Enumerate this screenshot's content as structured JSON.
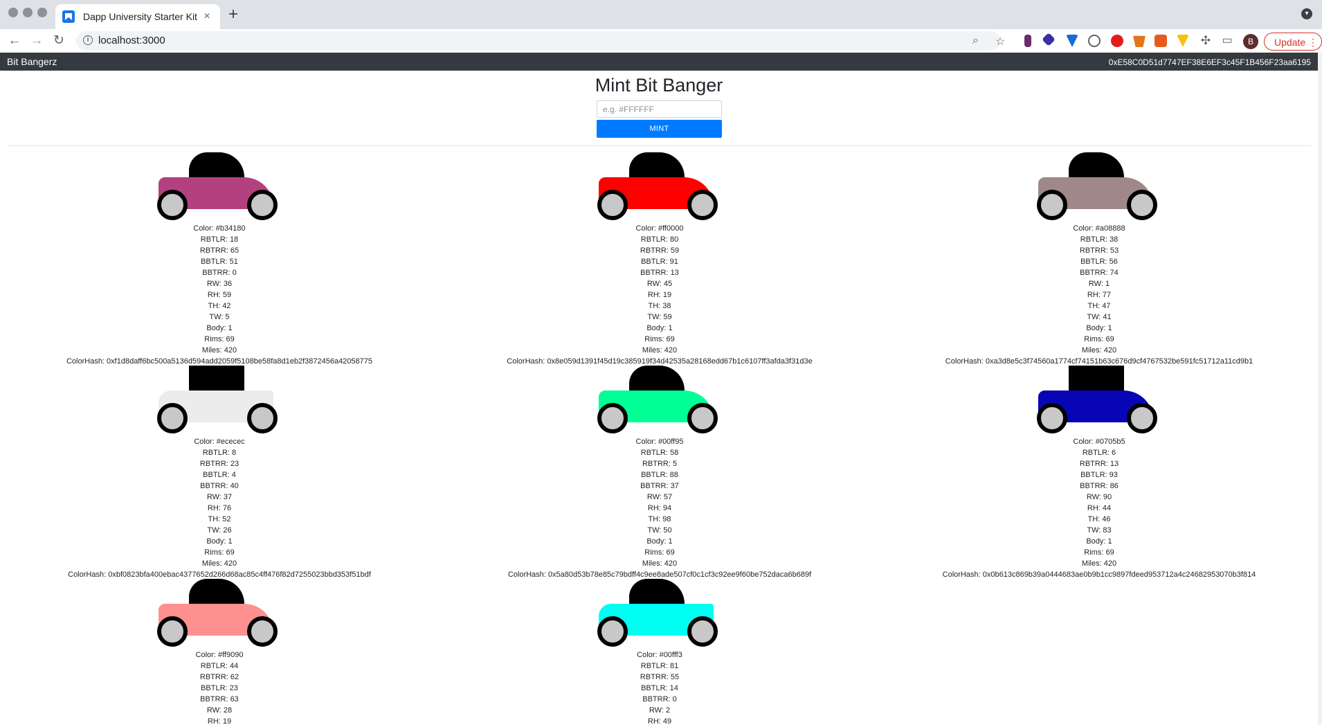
{
  "browser": {
    "tab_title": "Dapp University Starter Kit",
    "tab_close": "×",
    "new_tab": "+",
    "url": "localhost:3000",
    "avatar_letter": "B",
    "update_label": "Update"
  },
  "navbar": {
    "brand": "Bit Bangerz",
    "account": "0xE58C0D51d7747EF38E6EF3c45F1B456F23aa6195"
  },
  "mint": {
    "title": "Mint Bit Banger",
    "placeholder": "e.g. #FFFFFF",
    "button_label": "MINT"
  },
  "cars": [
    {
      "color": "#b34180",
      "body_color": "#b34180",
      "roof_shape": "rounded",
      "body_shape": "rounded",
      "stats": [
        "Color: #b34180",
        "RBTLR: 18",
        "RBTRR: 65",
        "BBTLR: 51",
        "BBTRR: 0",
        "RW: 36",
        "RH: 59",
        "TH: 42",
        "TW: 5",
        "Body: 1",
        "Rims: 69",
        "Miles: 420",
        "ColorHash: 0xf1d8daff6bc500a5136d594add2059f5108be58fa8d1eb2f3872456a42058775"
      ]
    },
    {
      "color": "#ff0000",
      "body_color": "#ff0000",
      "roof_shape": "rounded",
      "body_shape": "rounded",
      "stats": [
        "Color: #ff0000",
        "RBTLR: 80",
        "RBTRR: 59",
        "BBTLR: 91",
        "BBTRR: 13",
        "RW: 45",
        "RH: 19",
        "TH: 38",
        "TW: 59",
        "Body: 1",
        "Rims: 69",
        "Miles: 420",
        "ColorHash: 0x8e059d1391f45d19c385919f34d42535a28168edd67b1c6107ff3afda3f31d3e"
      ]
    },
    {
      "color": "#a08888",
      "body_color": "#a08888",
      "roof_shape": "rounded",
      "body_shape": "rounded",
      "stats": [
        "Color: #a08888",
        "RBTLR: 38",
        "RBTRR: 53",
        "BBTLR: 56",
        "BBTRR: 74",
        "RW: 1",
        "RH: 77",
        "TH: 47",
        "TW: 41",
        "Body: 1",
        "Rims: 69",
        "Miles: 420",
        "ColorHash: 0xa3d8e5c3f74560a1774cf74151b63c676d9cf4767532be591fc51712a11cd9b1"
      ]
    },
    {
      "color": "#ececec",
      "body_color": "#ececec",
      "roof_shape": "square",
      "body_shape": "square",
      "stats": [
        "Color: #ececec",
        "RBTLR: 8",
        "RBTRR: 23",
        "BBTLR: 4",
        "BBTRR: 40",
        "RW: 37",
        "RH: 76",
        "TH: 52",
        "TW: 26",
        "Body: 1",
        "Rims: 69",
        "Miles: 420",
        "ColorHash: 0xbf0823bfa400ebac4377652d266d68ac85c4ff476f82d7255023bbd353f51bdf"
      ]
    },
    {
      "color": "#00ff95",
      "body_color": "#00ff95",
      "roof_shape": "rounded",
      "body_shape": "rounded",
      "stats": [
        "Color: #00ff95",
        "RBTLR: 58",
        "RBTRR: 5",
        "BBTLR: 88",
        "BBTRR: 37",
        "RW: 57",
        "RH: 94",
        "TH: 98",
        "TW: 50",
        "Body: 1",
        "Rims: 69",
        "Miles: 420",
        "ColorHash: 0x5a80d53b78e85c79bdff4c9ee8ade507cf0c1cf3c92ee9f60be752daca6b689f"
      ]
    },
    {
      "color": "#0705b5",
      "body_color": "#0705b5",
      "roof_shape": "square",
      "body_shape": "rounded",
      "stats": [
        "Color: #0705b5",
        "RBTLR: 6",
        "RBTRR: 13",
        "BBTLR: 93",
        "BBTRR: 86",
        "RW: 90",
        "RH: 44",
        "TH: 46",
        "TW: 83",
        "Body: 1",
        "Rims: 69",
        "Miles: 420",
        "ColorHash: 0x0b613c869b39a0444683ae0b9b1cc9897fdeed953712a4c24682953070b3f814"
      ]
    },
    {
      "color": "#ff9090",
      "body_color": "#ff9090",
      "roof_shape": "rounded",
      "body_shape": "rounded",
      "stats": [
        "Color: #ff9090",
        "RBTLR: 44",
        "RBTRR: 62",
        "BBTLR: 23",
        "BBTRR: 63",
        "RW: 28",
        "RH: 19"
      ]
    },
    {
      "color": "#00fff3",
      "body_color": "#00fff3",
      "roof_shape": "rounded",
      "body_shape": "square",
      "stats": [
        "Color: #00fff3",
        "RBTLR: 81",
        "RBTRR: 55",
        "BBTLR: 14",
        "BBTRR: 0",
        "RW: 2",
        "RH: 49"
      ]
    }
  ]
}
